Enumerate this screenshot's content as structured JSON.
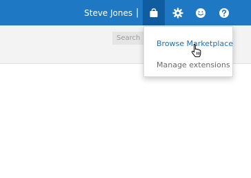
{
  "header": {
    "user_name": "Steve Jones",
    "separator": "|",
    "icons": [
      "marketplace-bag-icon",
      "gear-icon",
      "smiley-feedback-icon",
      "help-icon"
    ],
    "colors": {
      "bar": "#1f78c4",
      "active": "#105ca0"
    }
  },
  "toolbar": {
    "search_placeholder": "Search"
  },
  "marketplace_menu": {
    "items": [
      {
        "label": "Browse Marketplace",
        "color": "#1e6fb0"
      },
      {
        "label": "Manage extensions",
        "color": "#6b6b6b"
      }
    ]
  }
}
